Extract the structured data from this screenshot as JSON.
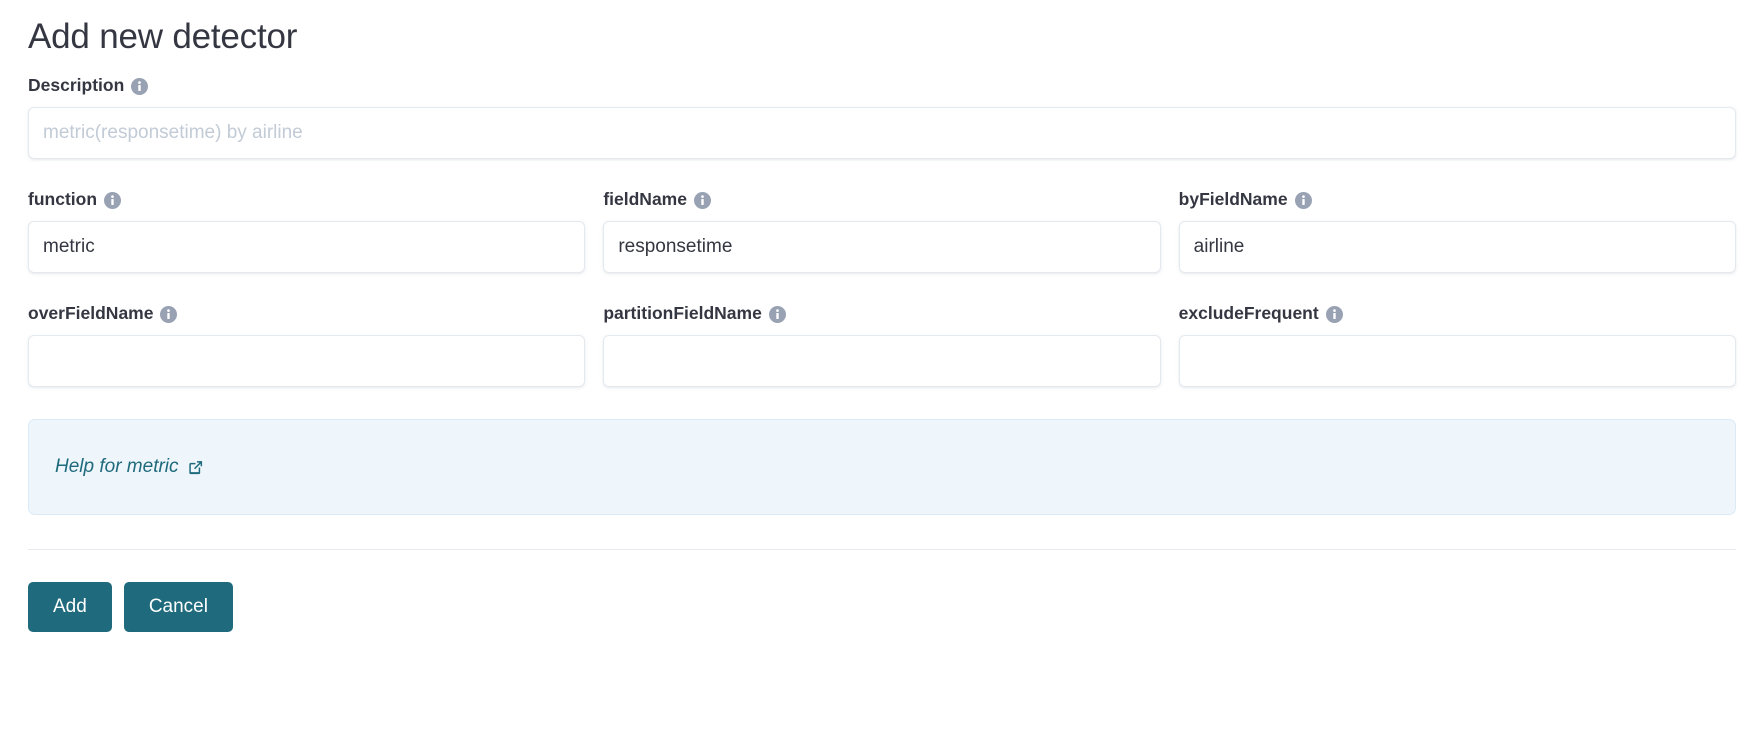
{
  "page": {
    "title": "Add new detector"
  },
  "description": {
    "label": "Description",
    "info_icon": "info-icon",
    "value": "",
    "placeholder": "metric(responsetime) by airline"
  },
  "fields": [
    {
      "name": "function",
      "label": "function",
      "info_icon": "info-icon",
      "value": "metric",
      "placeholder": ""
    },
    {
      "name": "fieldName",
      "label": "fieldName",
      "info_icon": "info-icon",
      "value": "responsetime",
      "placeholder": ""
    },
    {
      "name": "byFieldName",
      "label": "byFieldName",
      "info_icon": "info-icon",
      "value": "airline",
      "placeholder": ""
    },
    {
      "name": "overFieldName",
      "label": "overFieldName",
      "info_icon": "info-icon",
      "value": "",
      "placeholder": ""
    },
    {
      "name": "partitionFieldName",
      "label": "partitionFieldName",
      "info_icon": "info-icon",
      "value": "",
      "placeholder": ""
    },
    {
      "name": "excludeFrequent",
      "label": "excludeFrequent",
      "info_icon": "info-icon",
      "value": "",
      "placeholder": ""
    }
  ],
  "help": {
    "link_text": "Help for metric",
    "external_icon": "external-link-icon"
  },
  "footer": {
    "add_label": "Add",
    "cancel_label": "Cancel"
  },
  "colors": {
    "accent": "#1f6a7c",
    "title_text": "#343741",
    "label_text": "#343741",
    "placeholder_text": "#c2cbd6",
    "input_border": "#e4e9ee",
    "help_background": "#eef6fb",
    "help_border": "#dbeaf5",
    "info_icon_fill": "#98a2b3",
    "divider": "#e7ebef"
  }
}
